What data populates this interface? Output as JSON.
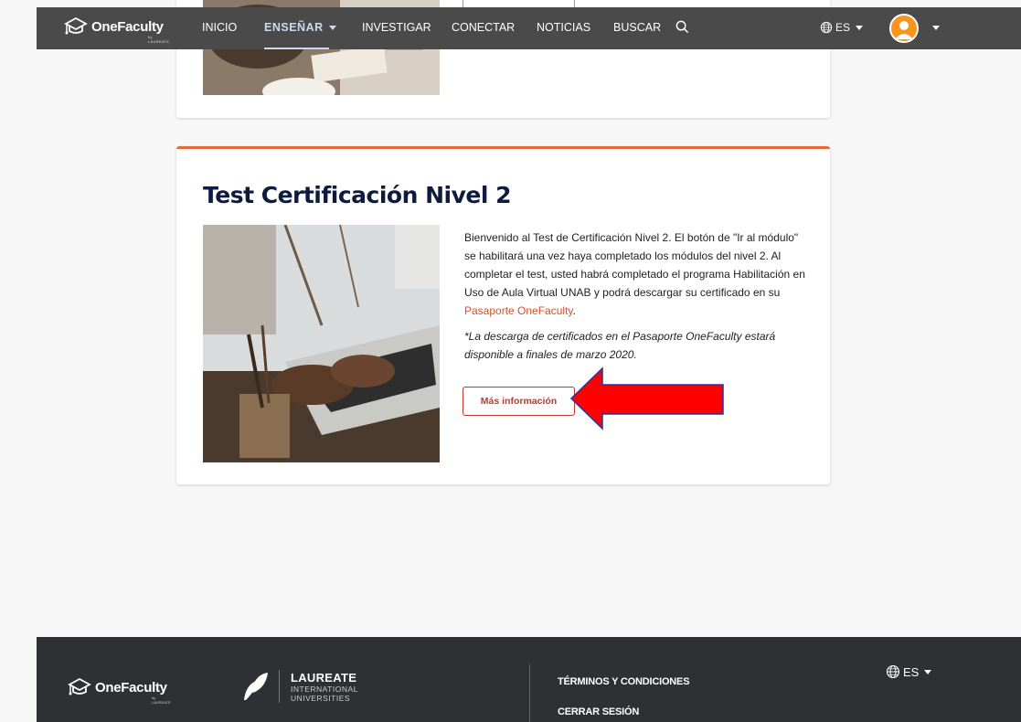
{
  "nav": {
    "brand": "OneFaculty",
    "brand_sub": "by LAUREATE",
    "items": [
      "INICIO",
      "ENSEÑAR",
      "INVESTIGAR",
      "CONECTAR",
      "NOTICIAS",
      "BUSCAR"
    ],
    "language": "ES"
  },
  "card": {
    "title": "Test Certificación Nivel 2",
    "description": "Bienvenido al Test de Certificación Nivel 2. El botón de \"Ir al módulo\" se habilitará una vez haya completado los módulos del nivel 2. Al completar el test, usted habrá completado el programa Habilitación en Uso de Aula Virtual UNAB y podrá descargar su certificado en su ",
    "link_text": "Pasaporte OneFaculty",
    "description_end": ".",
    "note": "*La descarga de certificados en el Pasaporte OneFaculty estará disponible a finales de marzo 2020.",
    "button_label": "Más información"
  },
  "colors": {
    "accent": "#e26b3a",
    "button": "#c0392b",
    "title": "#0d1b3e",
    "annotation_arrow": "#ff0000"
  },
  "footer": {
    "brand": "OneFaculty",
    "brand_sub": "by LAUREATE",
    "partner_name": "LAUREATE",
    "partner_sub1": "INTERNATIONAL",
    "partner_sub2": "UNIVERSITIES",
    "links": [
      "TÉRMINOS Y CONDICIONES",
      "CERRAR SESIÓN"
    ],
    "language": "ES"
  }
}
